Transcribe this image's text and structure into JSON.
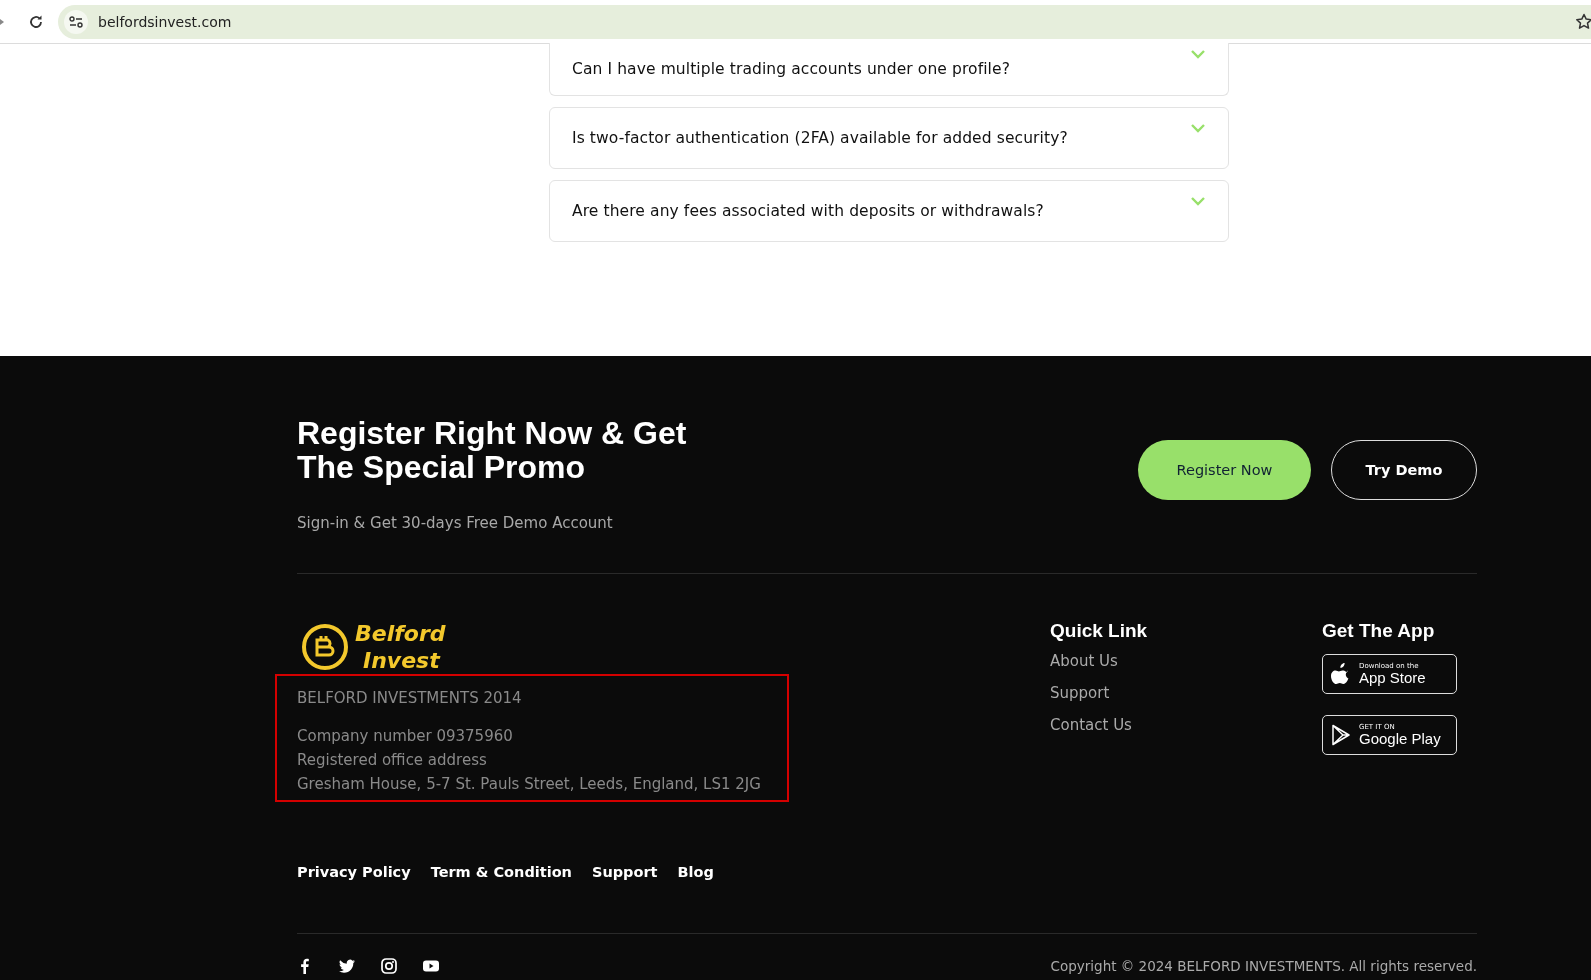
{
  "browser": {
    "url": "belfordsinvest.com"
  },
  "faq": [
    {
      "question": "Can I have multiple trading accounts under one profile?",
      "expanded": false
    },
    {
      "question": "Is two-factor authentication (2FA) available for added security?",
      "expanded": false
    },
    {
      "question": "Are there any fees associated with deposits or withdrawals?",
      "expanded": false
    }
  ],
  "cta": {
    "title": "Register Right Now & Get The Special Promo",
    "subtitle": "Sign-in & Get 30-days Free Demo Account",
    "buttons": [
      {
        "label": "Register Now",
        "kind": "primary"
      },
      {
        "label": "Try Demo",
        "kind": "outline"
      }
    ]
  },
  "brand": {
    "line1": "Belford",
    "line2": "Invest"
  },
  "company": {
    "highlighted": true,
    "name": "BELFORD INVESTMENTS 2014",
    "lines": [
      "Company number 09375960",
      "Registered office address",
      "Gresham House, 5-7 St. Pauls Street, Leeds, England, LS1 2JG"
    ]
  },
  "quick_links": {
    "title": "Quick Link",
    "items": [
      "About Us",
      "Support",
      "Contact Us"
    ]
  },
  "app": {
    "title": "Get The App",
    "badges": [
      {
        "kind": "apple",
        "small": "Download on the",
        "big": "App Store"
      },
      {
        "kind": "google",
        "small": "GET IT ON",
        "big": "Google Play"
      }
    ]
  },
  "bottom_links": [
    "Privacy Policy",
    "Term & Condition",
    "Support",
    "Blog"
  ],
  "social": [
    {
      "kind": "facebook"
    },
    {
      "kind": "twitter"
    },
    {
      "kind": "instagram"
    },
    {
      "kind": "youtube"
    }
  ],
  "copyright": "Copyright © 2024 BELFORD INVESTMENTS. All rights reserved."
}
